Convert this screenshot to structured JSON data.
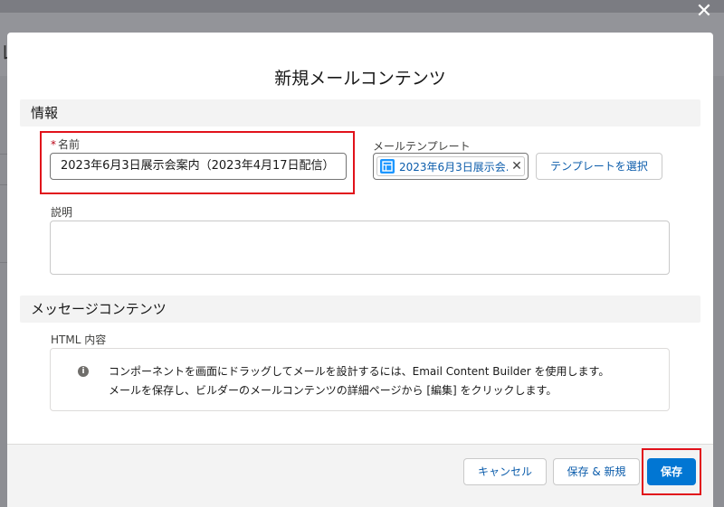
{
  "background": {
    "left_glyph": "レ"
  },
  "overlay": {
    "close_label": "✕"
  },
  "modal": {
    "title": "新規メールコンテンツ",
    "sections": {
      "info": "情報",
      "message_content": "メッセージコンテンツ"
    },
    "name_field": {
      "required_mark": "*",
      "label": "名前",
      "value": "2023年6月3日展示会案内（2023年4月17日配信）"
    },
    "template_field": {
      "label": "メールテンプレート",
      "selected_pill": "2023年6月3日展示会...",
      "remove_label": "✕",
      "select_button": "テンプレートを選択"
    },
    "description_field": {
      "label": "説明",
      "value": ""
    },
    "html_content": {
      "label": "HTML 内容",
      "info_icon": "i",
      "line1": "コンポーネントを画面にドラッグしてメールを設計するには、Email Content Builder を使用します。",
      "line2": "メールを保存し、ビルダーのメールコンテンツの詳細ページから [編集] をクリックします。"
    },
    "footer": {
      "cancel": "キャンセル",
      "save_new": "保存 & 新規",
      "save": "保存"
    }
  },
  "colors": {
    "brand": "#0176d3",
    "highlight": "#e1121b",
    "link": "#0b5cab"
  }
}
